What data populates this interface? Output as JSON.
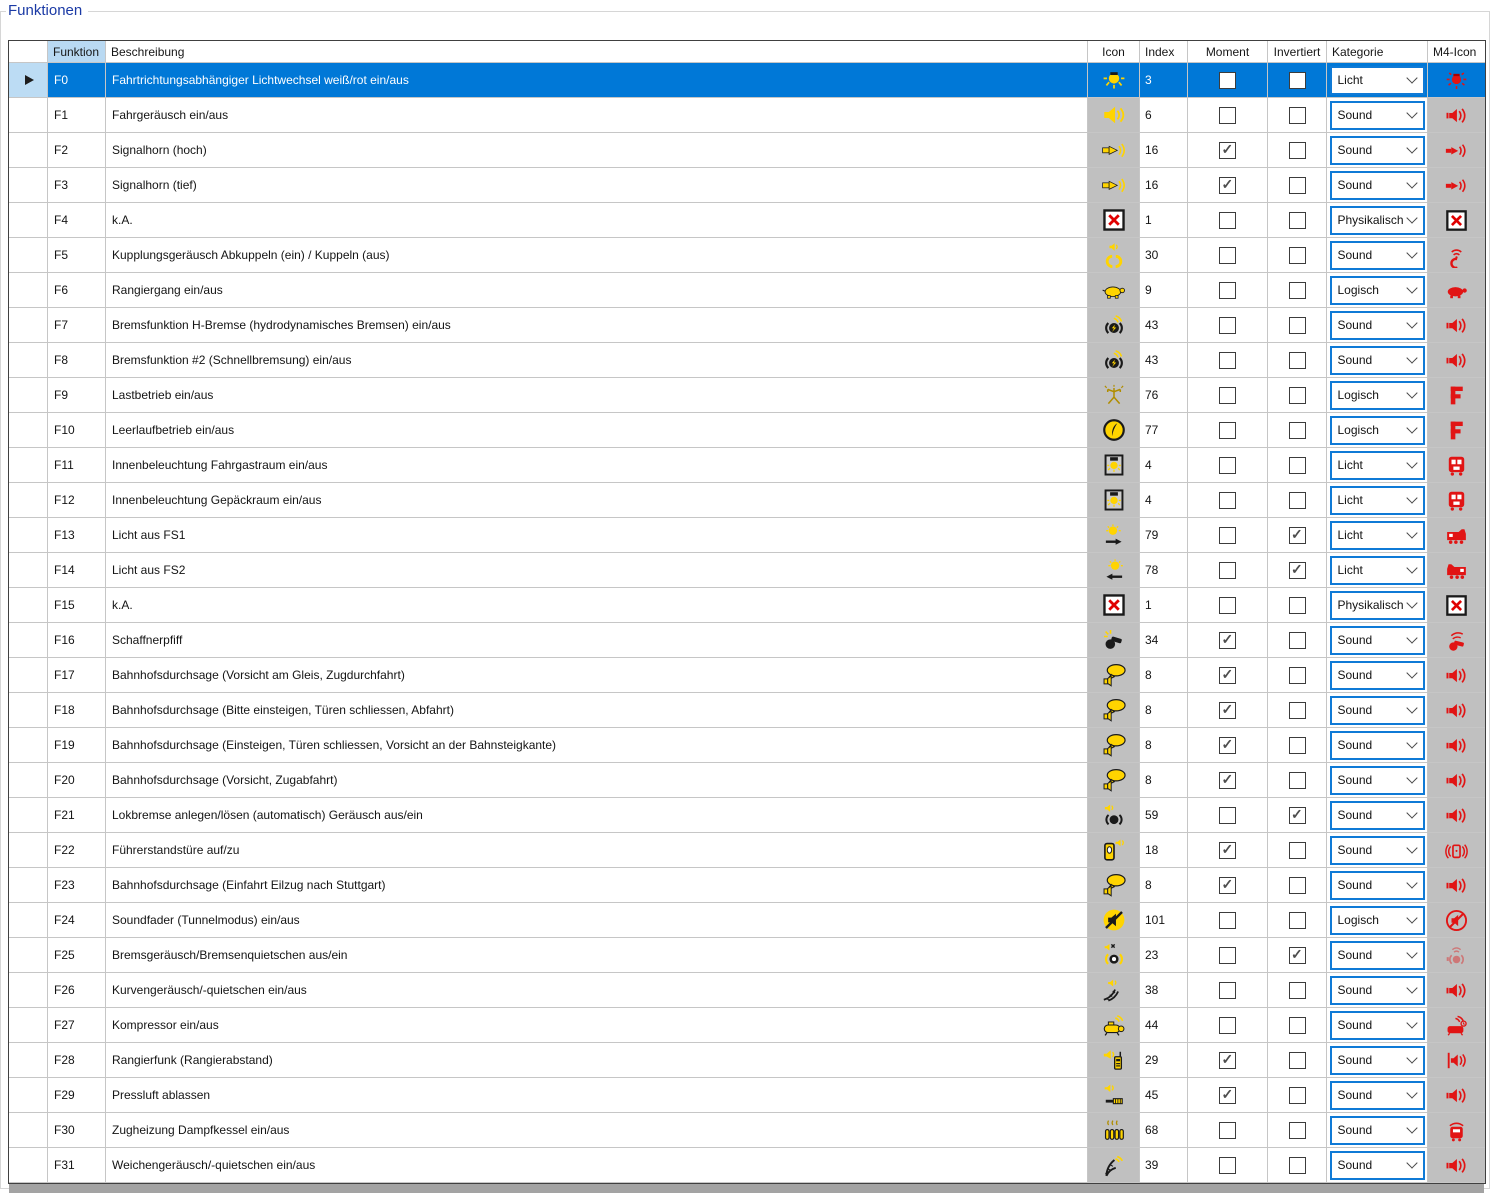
{
  "groupbox": {
    "title": "Funktionen"
  },
  "ui_colors": {
    "selection_blue": "#0078d7",
    "sorted_column_header": "#b9d9f2",
    "icon_cell_background": "#c0c0c0",
    "function_icon_yellow": "#ffd400",
    "m4_icon_red": "#e11414",
    "title_blue": "#1b3aa5",
    "combobox_border": "#0f7ad6"
  },
  "table": {
    "columns": {
      "funktion": "Funktion",
      "beschreibung": "Beschreibung",
      "icon": "Icon",
      "index": "Index",
      "moment": "Moment",
      "invertiert": "Invertiert",
      "kategorie": "Kategorie",
      "m4": "M4-Icon"
    },
    "selected_row": 0,
    "rows": [
      {
        "funktion": "F0",
        "beschreibung": "Fahrtrichtungsabhängiger Lichtwechsel weiß/rot ein/aus",
        "icon": "bulb-rays",
        "index": "3",
        "moment": false,
        "invertiert": false,
        "kategorie": "Licht",
        "m4": "m4-light"
      },
      {
        "funktion": "F1",
        "beschreibung": "Fahrgeräusch ein/aus",
        "icon": "speaker",
        "index": "6",
        "moment": false,
        "invertiert": false,
        "kategorie": "Sound",
        "m4": "m4-speaker"
      },
      {
        "funktion": "F2",
        "beschreibung": "Signalhorn (hoch)",
        "icon": "horn",
        "index": "16",
        "moment": true,
        "invertiert": false,
        "kategorie": "Sound",
        "m4": "m4-horn"
      },
      {
        "funktion": "F3",
        "beschreibung": "Signalhorn (tief)",
        "icon": "horn",
        "index": "16",
        "moment": true,
        "invertiert": false,
        "kategorie": "Sound",
        "m4": "m4-horn"
      },
      {
        "funktion": "F4",
        "beschreibung": "k.A.",
        "icon": "red-x",
        "index": "1",
        "moment": false,
        "invertiert": false,
        "kategorie": "Physikalisch",
        "m4": "m4-x"
      },
      {
        "funktion": "F5",
        "beschreibung": "Kupplungsgeräusch Abkuppeln (ein) / Kuppeln (aus)",
        "icon": "coupler-sound",
        "index": "30",
        "moment": false,
        "invertiert": false,
        "kategorie": "Sound",
        "m4": "m4-coupler"
      },
      {
        "funktion": "F6",
        "beschreibung": "Rangiergang ein/aus",
        "icon": "turtle",
        "index": "9",
        "moment": false,
        "invertiert": false,
        "kategorie": "Logisch",
        "m4": "m4-turtle"
      },
      {
        "funktion": "F7",
        "beschreibung": "Bremsfunktion H-Bremse (hydrodynamisches Bremsen) ein/aus",
        "icon": "brake-sound",
        "index": "43",
        "moment": false,
        "invertiert": false,
        "kategorie": "Sound",
        "m4": "m4-speaker"
      },
      {
        "funktion": "F8",
        "beschreibung": "Bremsfunktion #2 (Schnellbremsung) ein/aus",
        "icon": "brake-sound",
        "index": "43",
        "moment": false,
        "invertiert": false,
        "kategorie": "Sound",
        "m4": "m4-speaker"
      },
      {
        "funktion": "F9",
        "beschreibung": "Lastbetrieb ein/aus",
        "icon": "mast",
        "index": "76",
        "moment": false,
        "invertiert": false,
        "kategorie": "Logisch",
        "m4": "m4-F"
      },
      {
        "funktion": "F10",
        "beschreibung": "Leerlaufbetrieb ein/aus",
        "icon": "gauge",
        "index": "77",
        "moment": false,
        "invertiert": false,
        "kategorie": "Logisch",
        "m4": "m4-F"
      },
      {
        "funktion": "F11",
        "beschreibung": "Innenbeleuchtung Fahrgastraum ein/aus",
        "icon": "interior-light",
        "index": "4",
        "moment": false,
        "invertiert": false,
        "kategorie": "Licht",
        "m4": "m4-coach-front"
      },
      {
        "funktion": "F12",
        "beschreibung": "Innenbeleuchtung Gepäckraum ein/aus",
        "icon": "interior-light",
        "index": "4",
        "moment": false,
        "invertiert": false,
        "kategorie": "Licht",
        "m4": "m4-coach-front"
      },
      {
        "funktion": "F13",
        "beschreibung": "Licht aus FS1",
        "icon": "light-right",
        "index": "79",
        "moment": false,
        "invertiert": true,
        "kategorie": "Licht",
        "m4": "m4-loco-right"
      },
      {
        "funktion": "F14",
        "beschreibung": "Licht aus FS2",
        "icon": "light-left",
        "index": "78",
        "moment": false,
        "invertiert": true,
        "kategorie": "Licht",
        "m4": "m4-loco-left"
      },
      {
        "funktion": "F15",
        "beschreibung": "k.A.",
        "icon": "red-x",
        "index": "1",
        "moment": false,
        "invertiert": false,
        "kategorie": "Physikalisch",
        "m4": "m4-x"
      },
      {
        "funktion": "F16",
        "beschreibung": "Schaffnerpfiff",
        "icon": "whistle",
        "index": "34",
        "moment": true,
        "invertiert": false,
        "kategorie": "Sound",
        "m4": "m4-whistle"
      },
      {
        "funktion": "F17",
        "beschreibung": "Bahnhofsdurchsage (Vorsicht am Gleis, Zugdurchfahrt)",
        "icon": "announcement",
        "index": "8",
        "moment": true,
        "invertiert": false,
        "kategorie": "Sound",
        "m4": "m4-speaker"
      },
      {
        "funktion": "F18",
        "beschreibung": "Bahnhofsdurchsage (Bitte einsteigen, Türen schliessen, Abfahrt)",
        "icon": "announcement",
        "index": "8",
        "moment": true,
        "invertiert": false,
        "kategorie": "Sound",
        "m4": "m4-speaker"
      },
      {
        "funktion": "F19",
        "beschreibung": "Bahnhofsdurchsage (Einsteigen, Türen schliessen, Vorsicht an der Bahnsteigkante)",
        "icon": "announcement",
        "index": "8",
        "moment": true,
        "invertiert": false,
        "kategorie": "Sound",
        "m4": "m4-speaker"
      },
      {
        "funktion": "F20",
        "beschreibung": "Bahnhofsdurchsage (Vorsicht, Zugabfahrt)",
        "icon": "announcement",
        "index": "8",
        "moment": true,
        "invertiert": false,
        "kategorie": "Sound",
        "m4": "m4-speaker"
      },
      {
        "funktion": "F21",
        "beschreibung": "Lokbremse anlegen/lösen (automatisch) Geräusch aus/ein",
        "icon": "brake-sound2",
        "index": "59",
        "moment": false,
        "invertiert": true,
        "kategorie": "Sound",
        "m4": "m4-speaker"
      },
      {
        "funktion": "F22",
        "beschreibung": "Führerstandstüre auf/zu",
        "icon": "door-speaker",
        "index": "18",
        "moment": true,
        "invertiert": false,
        "kategorie": "Sound",
        "m4": "m4-door-sound"
      },
      {
        "funktion": "F23",
        "beschreibung": "Bahnhofsdurchsage (Einfahrt Eilzug nach Stuttgart)",
        "icon": "announcement",
        "index": "8",
        "moment": true,
        "invertiert": false,
        "kategorie": "Sound",
        "m4": "m4-speaker"
      },
      {
        "funktion": "F24",
        "beschreibung": "Soundfader (Tunnelmodus) ein/aus",
        "icon": "mute",
        "index": "101",
        "moment": false,
        "invertiert": false,
        "kategorie": "Logisch",
        "m4": "m4-mute"
      },
      {
        "funktion": "F25",
        "beschreibung": "Bremsgeräusch/Bremsenquietschen aus/ein",
        "icon": "brake-squeal-x",
        "index": "23",
        "moment": false,
        "invertiert": true,
        "kategorie": "Sound",
        "m4": "m4-brake-faded"
      },
      {
        "funktion": "F26",
        "beschreibung": "Kurvengeräusch/-quietschen ein/aus",
        "icon": "curve-squeal",
        "index": "38",
        "moment": false,
        "invertiert": false,
        "kategorie": "Sound",
        "m4": "m4-speaker"
      },
      {
        "funktion": "F27",
        "beschreibung": "Kompressor ein/aus",
        "icon": "compressor",
        "index": "44",
        "moment": false,
        "invertiert": false,
        "kategorie": "Sound",
        "m4": "m4-compressor"
      },
      {
        "funktion": "F28",
        "beschreibung": "Rangierfunk (Rangierabstand)",
        "icon": "radio",
        "index": "29",
        "moment": true,
        "invertiert": false,
        "kategorie": "Sound",
        "m4": "m4-speaker-pole"
      },
      {
        "funktion": "F29",
        "beschreibung": "Pressluft ablassen",
        "icon": "air-release",
        "index": "45",
        "moment": true,
        "invertiert": false,
        "kategorie": "Sound",
        "m4": "m4-speaker"
      },
      {
        "funktion": "F30",
        "beschreibung": "Zugheizung Dampfkessel ein/aus",
        "icon": "heating",
        "index": "68",
        "moment": false,
        "invertiert": false,
        "kategorie": "Sound",
        "m4": "m4-train-steam"
      },
      {
        "funktion": "F31",
        "beschreibung": "Weichengeräusch/-quietschen ein/aus",
        "icon": "turnout",
        "index": "39",
        "moment": false,
        "invertiert": false,
        "kategorie": "Sound",
        "m4": "m4-speaker"
      }
    ]
  }
}
